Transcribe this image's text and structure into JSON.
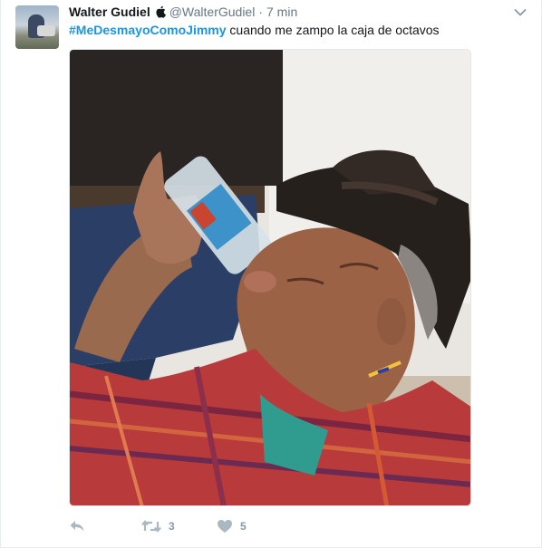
{
  "tweet": {
    "author_name": "Walter Gudiel",
    "author_handle": "@WalterGudiel",
    "separator": "·",
    "time": "7 min",
    "hashtag": "#MeDesmayoComoJimmy",
    "body": " cuando me zampo la caja de octavos",
    "retweet_count": "3",
    "like_count": "5"
  },
  "icons": {
    "verified_like_badge": "apple-icon",
    "menu": "chevron-down-icon",
    "reply": "reply-icon",
    "retweet": "retweet-icon",
    "like": "heart-icon"
  },
  "colors": {
    "hashtag": "#1b95e0",
    "muted": "#657786",
    "action": "#aab8c2",
    "border": "#e6ecf0"
  }
}
